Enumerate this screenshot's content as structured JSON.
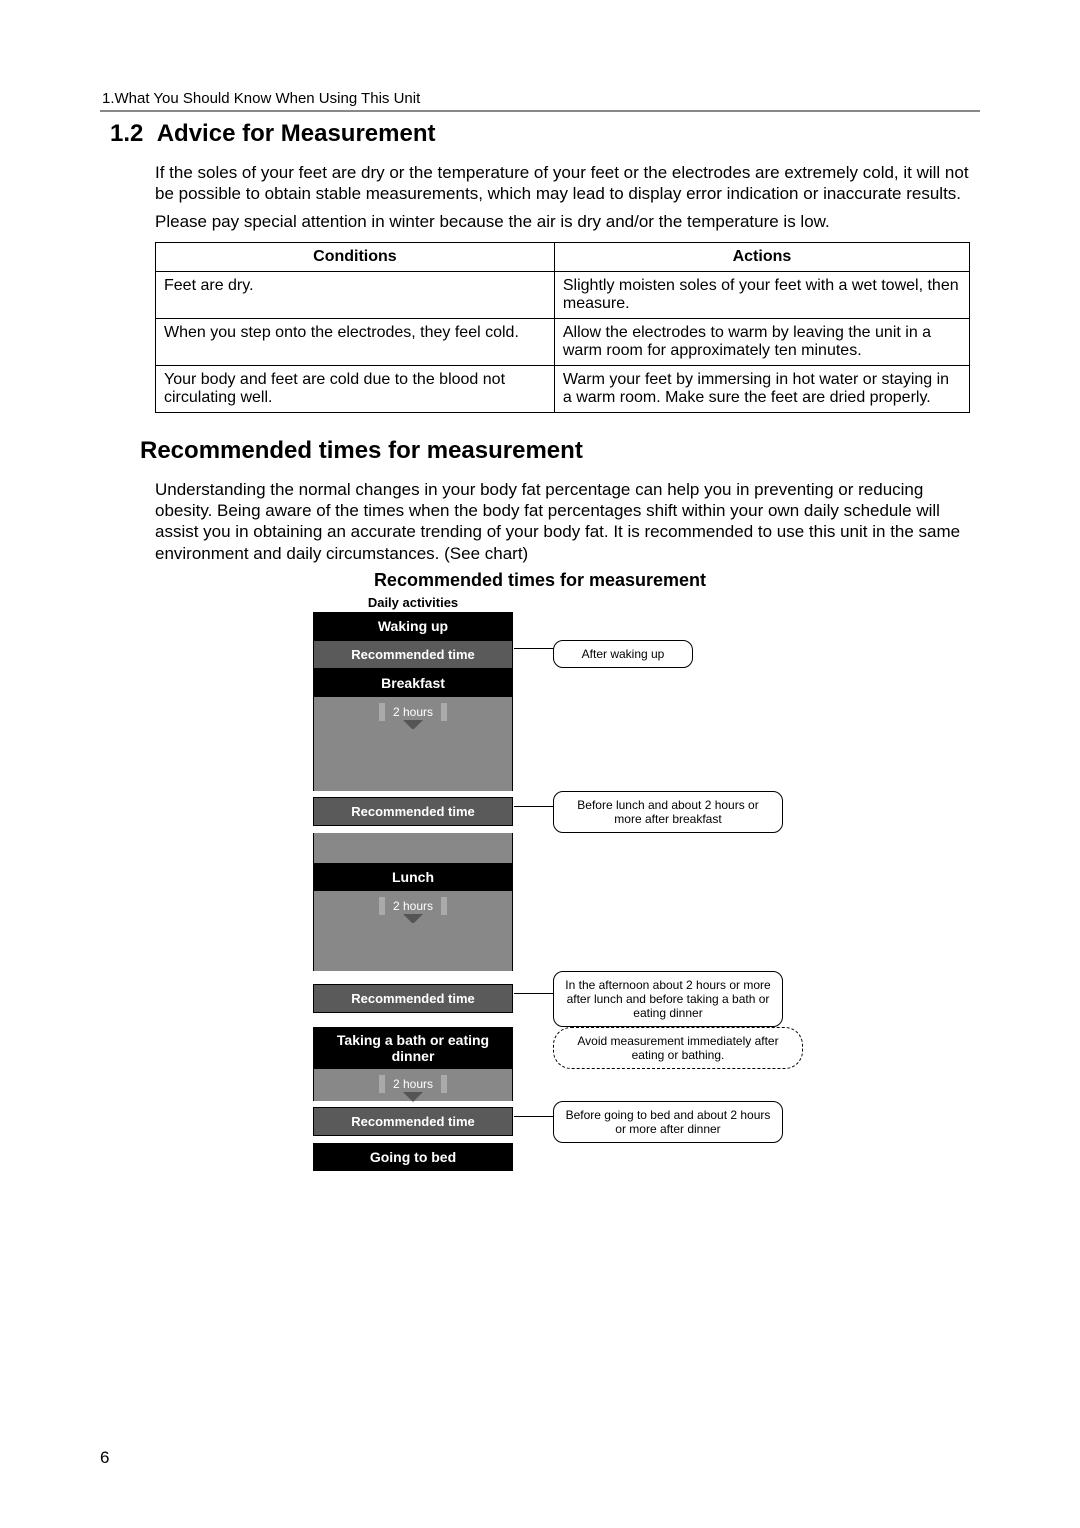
{
  "header": "1.What You Should Know When Using This Unit",
  "section_number": "1.2",
  "section_title": "Advice for Measurement",
  "intro_p1": "If the soles of your feet are dry or the temperature of your feet or the electrodes are extremely cold, it will not be possible to obtain stable measurements, which may lead to display error indication or inaccurate results.",
  "intro_p2": "Please pay special attention in winter because the air is dry and/or the temperature is low.",
  "table": {
    "head": {
      "c1": "Conditions",
      "c2": "Actions"
    },
    "rows": [
      {
        "c1": "Feet are dry.",
        "c2": "Slightly moisten soles of your feet with a wet towel, then measure."
      },
      {
        "c1": "When you step onto the electrodes, they feel cold.",
        "c2": "Allow the electrodes to warm by leaving the unit in a warm room for approximately ten minutes."
      },
      {
        "c1": "Your body and feet are cold due to the blood not circulating well.",
        "c2": "Warm your feet by immersing in hot water or staying in a warm room.  Make sure the feet are dried properly."
      }
    ]
  },
  "subhead": "Recommended times for measurement",
  "sub_para": "Understanding the normal changes in your body fat percentage can help you in preventing or reducing obesity. Being aware of the times when the body fat percentages shift within your own daily schedule will assist you in obtaining an accurate trending of your body fat. It is recommended to use this unit in the same environment and daily circumstances. (See chart)",
  "chart": {
    "title": "Recommended times for measurement",
    "daily_label": "Daily activities",
    "rec_label": "Recommended time",
    "two_hours": "2 hours",
    "acts": {
      "waking": "Waking up",
      "breakfast": "Breakfast",
      "lunch": "Lunch",
      "bath_dinner": "Taking a bath or eating dinner",
      "bed": "Going to bed"
    },
    "callouts": {
      "after_waking": "After waking up",
      "before_lunch": "Before lunch and about 2 hours or more after breakfast",
      "afternoon": "In the afternoon about 2 hours or more after lunch and before taking a bath or eating dinner",
      "avoid": "Avoid measurement immediately after eating or bathing.",
      "before_bed": "Before going to bed and about 2 hours or more after dinner"
    }
  },
  "page_number": "6"
}
